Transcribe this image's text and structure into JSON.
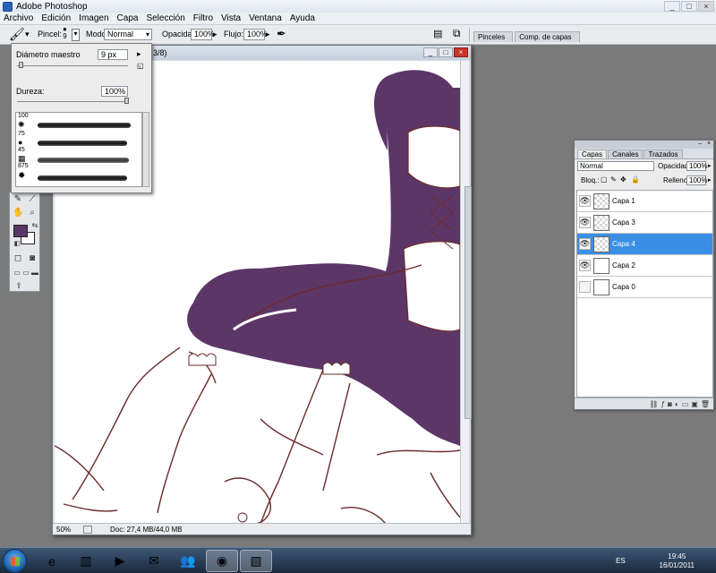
{
  "window": {
    "title": "Adobe Photoshop",
    "controls": [
      "_",
      "□",
      "×"
    ]
  },
  "menu": [
    "Archivo",
    "Edición",
    "Imagen",
    "Capa",
    "Selección",
    "Filtro",
    "Vista",
    "Ventana",
    "Ayuda"
  ],
  "options": {
    "pincel_label": "Pincel:",
    "pincel_size": "9",
    "modo_label": "Modo:",
    "modo_value": "Normal",
    "opacidad_label": "Opacidad:",
    "opacidad_value": "100%",
    "flujo_label": "Flujo:",
    "flujo_value": "100%"
  },
  "panel_well": [
    "Pinceles",
    "Comp. de capas"
  ],
  "brush_picker": {
    "diameter_label": "Diámetro maestro",
    "diameter_value": "9 px",
    "hardness_label": "Dureza:",
    "hardness_value": "100%",
    "presets": [
      "100",
      "75",
      "45",
      "875"
    ]
  },
  "document": {
    "title_suffix": "3/8)",
    "zoom": "50%",
    "doc_info": "Doc: 27,4 MB/44,0 MB"
  },
  "colors": {
    "foreground": "#5d3668",
    "background": "#ffffff",
    "selection": "#3a8ee6"
  },
  "layers_panel": {
    "tabs": [
      "Capas",
      "Canales",
      "Trazados"
    ],
    "blend_mode": "Normal",
    "opacity_label": "Opacidad:",
    "opacity_value": "100%",
    "lock_label": "Bloq.:",
    "fill_label": "Relleno:",
    "fill_value": "100%",
    "layers": [
      {
        "name": "Capa 1",
        "visible": true,
        "selected": false,
        "thumb": "transparent"
      },
      {
        "name": "Capa 3",
        "visible": true,
        "selected": false,
        "thumb": "transparent"
      },
      {
        "name": "Capa 4",
        "visible": true,
        "selected": true,
        "thumb": "transparent"
      },
      {
        "name": "Capa 2",
        "visible": true,
        "selected": false,
        "thumb": "white"
      },
      {
        "name": "Capa 0",
        "visible": false,
        "selected": false,
        "thumb": "white"
      }
    ]
  },
  "taskbar": {
    "lang": "ES",
    "time": "19:45",
    "date": "16/01/2011"
  }
}
